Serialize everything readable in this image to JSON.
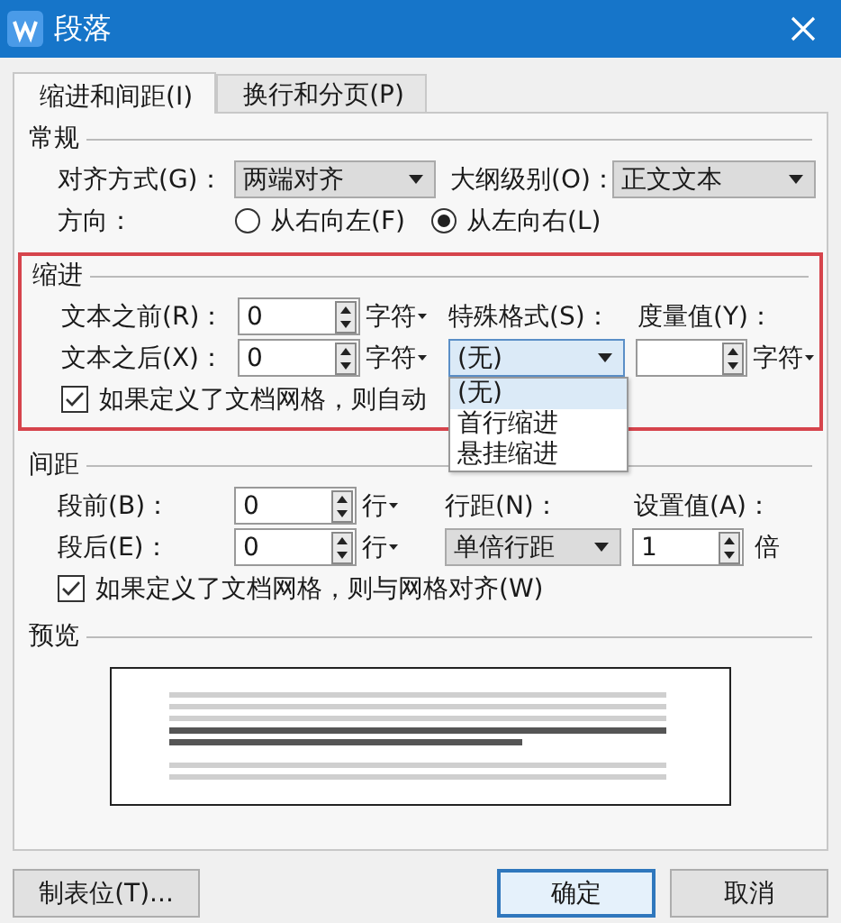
{
  "window": {
    "title": "段落"
  },
  "tabs": [
    {
      "label": "缩进和间距(I)",
      "selected": true
    },
    {
      "label": "换行和分页(P)",
      "selected": false
    }
  ],
  "general": {
    "title": "常规",
    "alignment": {
      "label": "对齐方式(G)：",
      "value": "两端对齐"
    },
    "outline_level": {
      "label": "大纲级别(O)：",
      "value": "正文文本"
    },
    "direction": {
      "label": "方向：",
      "options": [
        {
          "label": "从右向左(F)",
          "selected": false
        },
        {
          "label": "从左向右(L)",
          "selected": true
        }
      ]
    }
  },
  "indent": {
    "title": "缩进",
    "highlighted": true,
    "before": {
      "label": "文本之前(R)：",
      "value": "0",
      "unit": "字符"
    },
    "after": {
      "label": "文本之后(X)：",
      "value": "0",
      "unit": "字符"
    },
    "special": {
      "label": "特殊格式(S)：",
      "value": "(无)",
      "open": true,
      "options": [
        {
          "label": "(无)",
          "selected": true
        },
        {
          "label": "首行缩进",
          "selected": false
        },
        {
          "label": "悬挂缩进",
          "selected": false
        }
      ]
    },
    "measure": {
      "label": "度量值(Y)：",
      "unit": "字符"
    },
    "grid_checkbox": {
      "label": "如果定义了文档网格，则自动",
      "checked": true
    }
  },
  "spacing": {
    "title": "间距",
    "before": {
      "label": "段前(B)：",
      "value": "0",
      "unit": "行"
    },
    "after": {
      "label": "段后(E)：",
      "value": "0",
      "unit": "行"
    },
    "line_spacing": {
      "label": "行距(N)：",
      "value": "单倍行距"
    },
    "setting": {
      "label": "设置值(A)：",
      "value": "1",
      "unit": "倍"
    },
    "grid_checkbox": {
      "label": "如果定义了文档网格，则与网格对齐(W)",
      "checked": true
    }
  },
  "preview": {
    "title": "预览"
  },
  "buttons": [
    {
      "label": "制表位(T)...",
      "kind": "normal"
    },
    {
      "label": "确定",
      "kind": "default"
    },
    {
      "label": "取消",
      "kind": "normal"
    }
  ]
}
